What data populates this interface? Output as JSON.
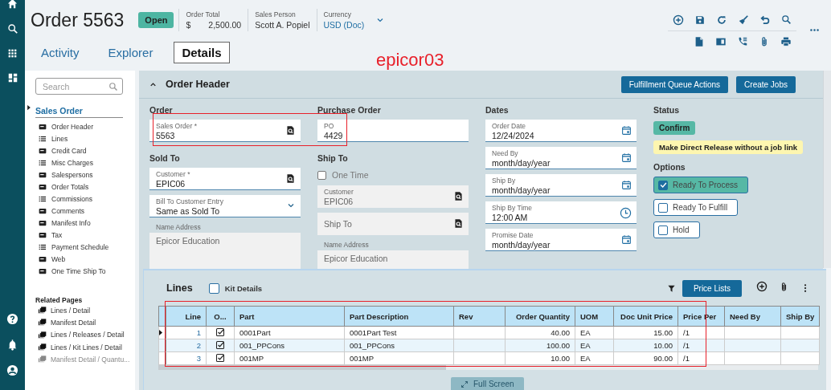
{
  "annotation": {
    "label": "epicor03"
  },
  "header": {
    "title": "Order 5563",
    "status": "Open",
    "info": [
      {
        "kind": "amount",
        "label": "Order Total",
        "prefix": "$",
        "value": "2,500.00"
      },
      {
        "kind": "text",
        "label": "Sales Person",
        "value": "Scott A. Popiel"
      },
      {
        "kind": "dropdown",
        "label": "Currency",
        "value": "USD (Doc)"
      }
    ]
  },
  "tabs": [
    {
      "label": "Activity",
      "selected": false
    },
    {
      "label": "Explorer",
      "selected": false
    },
    {
      "label": "Details",
      "selected": true
    }
  ],
  "nav": {
    "search": {
      "placeholder": "Search"
    },
    "section": "Sales Order",
    "items": [
      {
        "label": "Order Header",
        "kind": "card"
      },
      {
        "label": "Lines",
        "kind": "list"
      },
      {
        "label": "Credit Card",
        "kind": "card"
      },
      {
        "label": "Misc Charges",
        "kind": "list"
      },
      {
        "label": "Salespersons",
        "kind": "card"
      },
      {
        "label": "Order Totals",
        "kind": "card"
      },
      {
        "label": "Commissions",
        "kind": "list"
      },
      {
        "label": "Comments",
        "kind": "card"
      },
      {
        "label": "Manifest Info",
        "kind": "card"
      },
      {
        "label": "Tax",
        "kind": "card"
      },
      {
        "label": "Payment Schedule",
        "kind": "list"
      },
      {
        "label": "Web",
        "kind": "card"
      },
      {
        "label": "One Time Ship To",
        "kind": "card"
      }
    ],
    "related_title": "Related Pages",
    "related": [
      {
        "label": "Lines / Detail",
        "disabled": false
      },
      {
        "label": "Manifest Detail",
        "disabled": false
      },
      {
        "label": "Lines / Releases / Detail",
        "disabled": false
      },
      {
        "label": "Lines / Kit Lines / Detail",
        "disabled": false
      },
      {
        "label": "Manifest Detail / Quantu...",
        "disabled": true
      }
    ]
  },
  "panel": {
    "title": "Order Header",
    "actions": [
      "Fulfillment Queue Actions",
      "Create Jobs"
    ],
    "columns": [
      [
        {
          "title": "Order",
          "items": [
            {
              "kind": "lookup",
              "label": "Sales Order *",
              "value": "5563",
              "disabled": false
            }
          ]
        },
        {
          "title": "Sold To",
          "items": [
            {
              "kind": "lookup",
              "label": "Customer *",
              "value": "EPIC06",
              "disabled": false
            },
            {
              "kind": "dropdown",
              "label": "Bill To Customer Entry",
              "value": "Same as Sold To",
              "disabled": false
            },
            {
              "kind": "textarea",
              "label": "Name Address",
              "value": "Epicor Education",
              "disabled": true
            }
          ]
        }
      ],
      [
        {
          "title": "Purchase Order",
          "items": [
            {
              "kind": "text",
              "label": "PO",
              "value": "4429",
              "disabled": false
            }
          ]
        },
        {
          "title": "Ship To",
          "items": [
            {
              "kind": "checkbox",
              "label": "One Time",
              "checked": false
            },
            {
              "kind": "lookup",
              "label": "Customer",
              "value": "EPIC06",
              "disabled": true
            },
            {
              "kind": "lookup",
              "placeholder": "Ship To",
              "disabled": true
            },
            {
              "kind": "textarea",
              "label": "Name Address",
              "value": "Epicor Education",
              "disabled": true
            }
          ]
        }
      ],
      [
        {
          "title": "Dates",
          "items": [
            {
              "kind": "date",
              "label": "Order Date",
              "value": "12/24/2024",
              "disabled": false
            },
            {
              "kind": "date",
              "label": "Need By",
              "value": "month/day/year",
              "disabled": false
            },
            {
              "kind": "date",
              "label": "Ship By",
              "value": "month/day/year",
              "disabled": false
            },
            {
              "kind": "time",
              "label": "Ship By Time",
              "value": "12:00 AM",
              "disabled": false
            },
            {
              "kind": "date",
              "label": "Promise Date",
              "value": "month/day/year",
              "disabled": false
            }
          ]
        }
      ],
      [
        {
          "title": "Status",
          "items": [
            {
              "kind": "badge",
              "label": "Confirm"
            },
            {
              "kind": "notice",
              "label": "Make Direct Release without a job link"
            }
          ]
        },
        {
          "title": "Options",
          "items": [
            {
              "kind": "option",
              "label": "Ready To Process",
              "checked": true
            },
            {
              "kind": "option",
              "label": "Ready To Fulfill",
              "checked": false
            },
            {
              "kind": "option",
              "label": "Hold",
              "checked": false
            }
          ]
        }
      ]
    ]
  },
  "lines": {
    "title": "Lines",
    "kit_details": {
      "label": "Kit Details",
      "checked": false
    },
    "action": "Price Lists",
    "columns": [
      "Line",
      "O...",
      "Part",
      "Part Description",
      "Rev",
      "Order Quantity",
      "UOM",
      "Doc Unit Price",
      "Price Per",
      "Need By",
      "Ship By"
    ],
    "rows": [
      {
        "selected": true,
        "line": "1",
        "o_checked": true,
        "part": "0001Part",
        "part_description": "0001Part Test",
        "order_quantity": "40.00",
        "uom": "EA",
        "doc_unit_price": "15.00",
        "price_per": "/1"
      },
      {
        "selected": false,
        "line": "2",
        "o_checked": true,
        "part": "001_PPCons",
        "part_description": "001_PPCons",
        "order_quantity": "100.00",
        "uom": "EA",
        "doc_unit_price": "10.00",
        "price_per": "/1"
      },
      {
        "selected": false,
        "line": "3",
        "o_checked": true,
        "part": "001MP",
        "part_description": "001MP",
        "order_quantity": "10.00",
        "uom": "EA",
        "doc_unit_price": "90.00",
        "price_per": "/1"
      }
    ],
    "full_screen": "Full Screen"
  }
}
